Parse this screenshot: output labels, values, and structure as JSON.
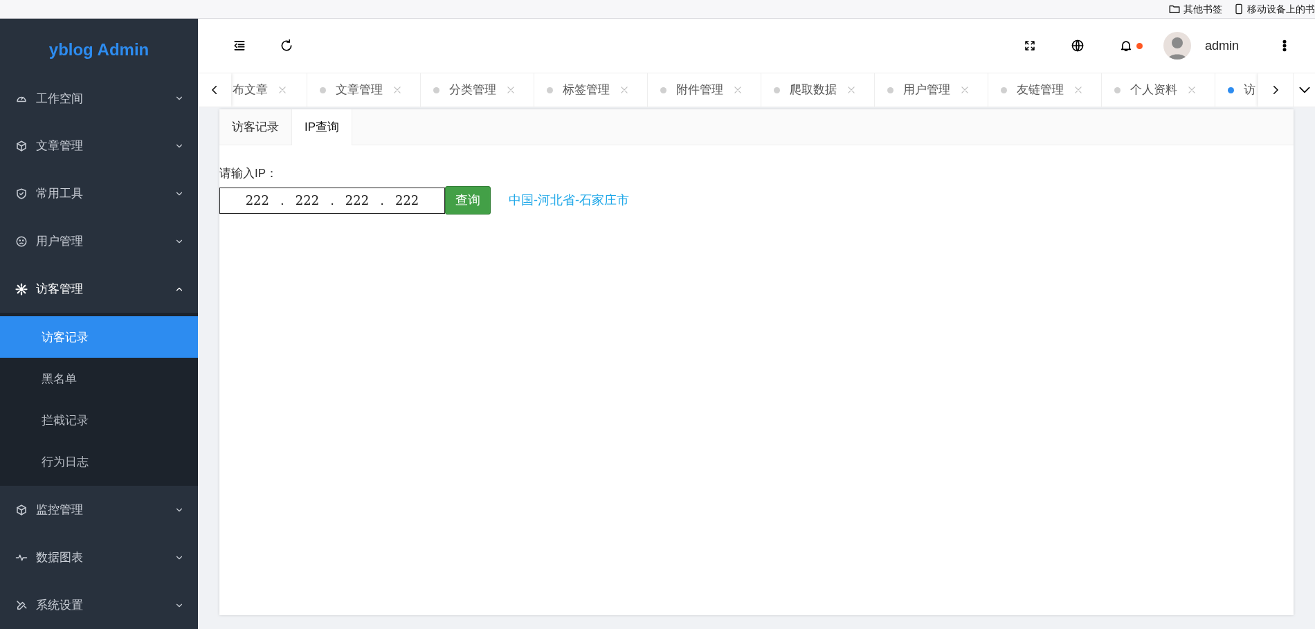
{
  "bookmarks_bar": {
    "items": [
      {
        "label": "其他书签"
      },
      {
        "label": "移动设备上的书"
      }
    ]
  },
  "sidebar": {
    "logo": "yblog Admin",
    "items": [
      {
        "label": "工作空间",
        "expanded": false
      },
      {
        "label": "文章管理",
        "expanded": false
      },
      {
        "label": "常用工具",
        "expanded": false
      },
      {
        "label": "用户管理",
        "expanded": false
      },
      {
        "label": "访客管理",
        "expanded": true,
        "children": [
          {
            "label": "访客记录",
            "selected": true
          },
          {
            "label": "黑名单",
            "selected": false
          },
          {
            "label": "拦截记录",
            "selected": false
          },
          {
            "label": "行为日志",
            "selected": false
          }
        ]
      },
      {
        "label": "监控管理",
        "expanded": false
      },
      {
        "label": "数据图表",
        "expanded": false
      },
      {
        "label": "系统设置",
        "expanded": false
      }
    ]
  },
  "header": {
    "user": "admin",
    "notification_unread": true
  },
  "page_tabs": [
    {
      "label": "布文章",
      "selected": false
    },
    {
      "label": "文章管理",
      "selected": false
    },
    {
      "label": "分类管理",
      "selected": false
    },
    {
      "label": "标签管理",
      "selected": false
    },
    {
      "label": "附件管理",
      "selected": false
    },
    {
      "label": "爬取数据",
      "selected": false
    },
    {
      "label": "用户管理",
      "selected": false
    },
    {
      "label": "友链管理",
      "selected": false
    },
    {
      "label": "个人资料",
      "selected": false
    },
    {
      "label": "访",
      "selected": true
    }
  ],
  "card": {
    "tabs": [
      {
        "label": "访客记录",
        "selected": false
      },
      {
        "label": "IP查询",
        "selected": true
      }
    ],
    "ip_label": "请输入IP：",
    "ip_octets": [
      "222",
      "222",
      "222",
      "222"
    ],
    "ip_separator": ".",
    "query_button": "查询",
    "result": "中国-河北省-石家庄市"
  }
}
